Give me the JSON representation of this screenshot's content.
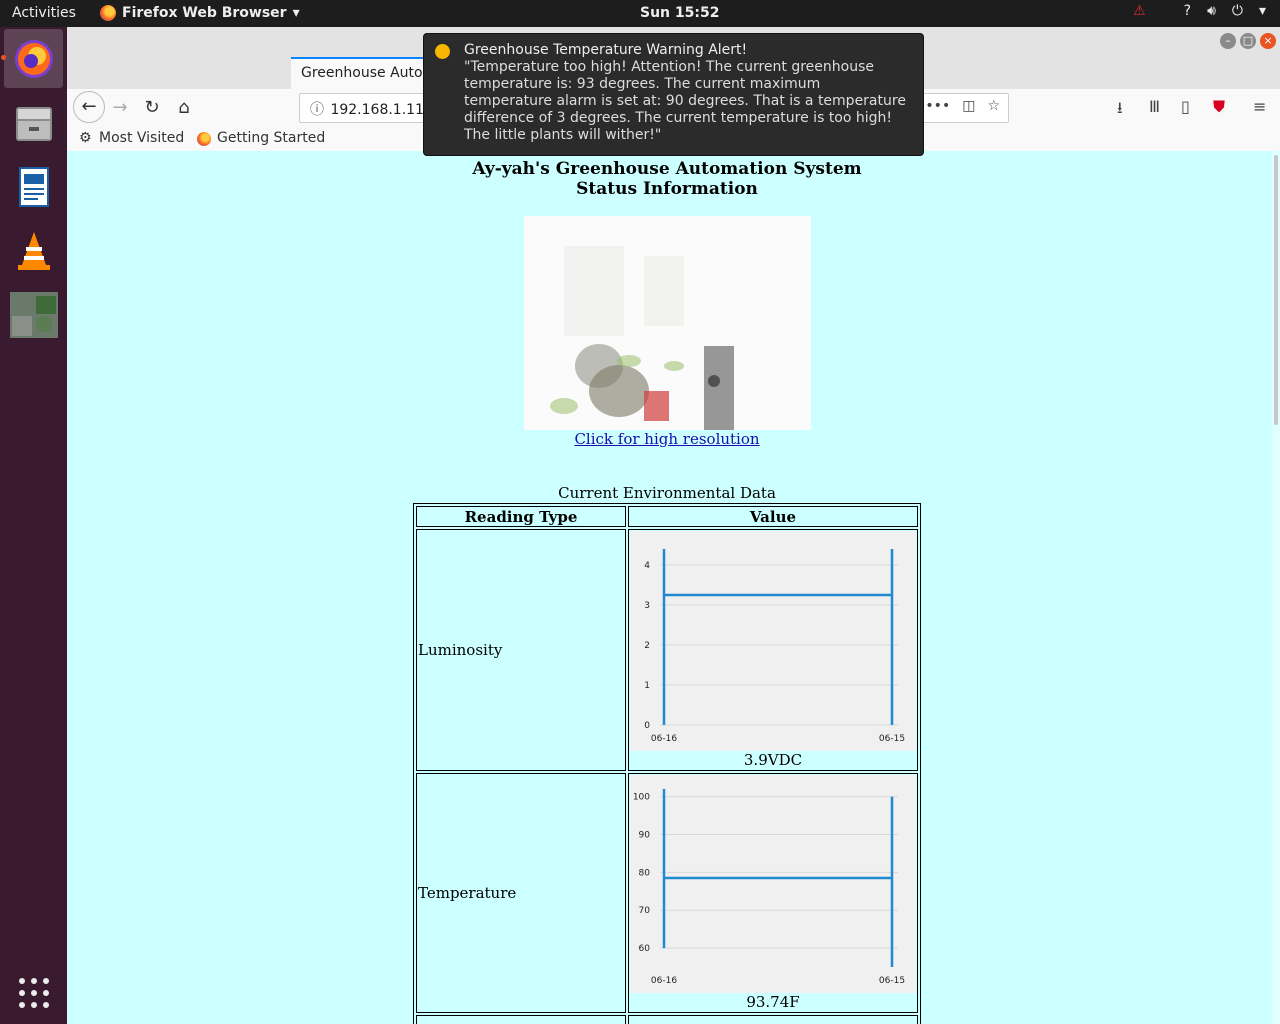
{
  "topbar": {
    "activities": "Activities",
    "app_name": "Firefox Web Browser",
    "clock": "Sun 15:52"
  },
  "browser": {
    "tab_title": "Greenhouse Auton",
    "url": "192.168.1.118",
    "bookmarks": [
      "Most Visited",
      "Getting Started"
    ]
  },
  "notification": {
    "title": "Greenhouse Temperature Warning Alert!",
    "body": "\"Temperature too high! Attention! The current greenhouse temperature is: 93 degrees. The current maximum temperature alarm is set at: 90 degrees. That is a temperature difference of 3 degrees. The current temperature is too high! The little plants will wither!\""
  },
  "page": {
    "title_line1": "Ay-yah's Greenhouse Automation System",
    "title_line2": "Status Information",
    "hires_link": "Click for high resolution",
    "table_caption": "Current Environmental Data",
    "col_reading": "Reading Type",
    "col_value": "Value",
    "rows": [
      {
        "label": "Luminosity",
        "reading": "3.9VDC"
      },
      {
        "label": "Temperature",
        "reading": "93.74F"
      }
    ]
  },
  "chart_data": [
    {
      "type": "line",
      "title": "",
      "x": [
        "06-16",
        "06-15"
      ],
      "yticks": [
        0,
        1,
        2,
        3,
        4
      ],
      "ylim": [
        0,
        4.5
      ],
      "series": [
        {
          "values": [
            3.25,
            3.25
          ]
        }
      ],
      "spikes": {
        "left": [
          0,
          4.4
        ],
        "right": [
          0,
          4.4
        ]
      },
      "color": "#1f8ad1"
    },
    {
      "type": "line",
      "title": "",
      "x": [
        "06-16",
        "06-15"
      ],
      "yticks": [
        60,
        70,
        80,
        90,
        100
      ],
      "ylim": [
        55,
        102
      ],
      "series": [
        {
          "values": [
            78.5,
            78.5
          ]
        }
      ],
      "spikes": {
        "left": [
          60,
          102
        ],
        "right": [
          55,
          100
        ]
      },
      "color": "#1f8ad1"
    }
  ]
}
